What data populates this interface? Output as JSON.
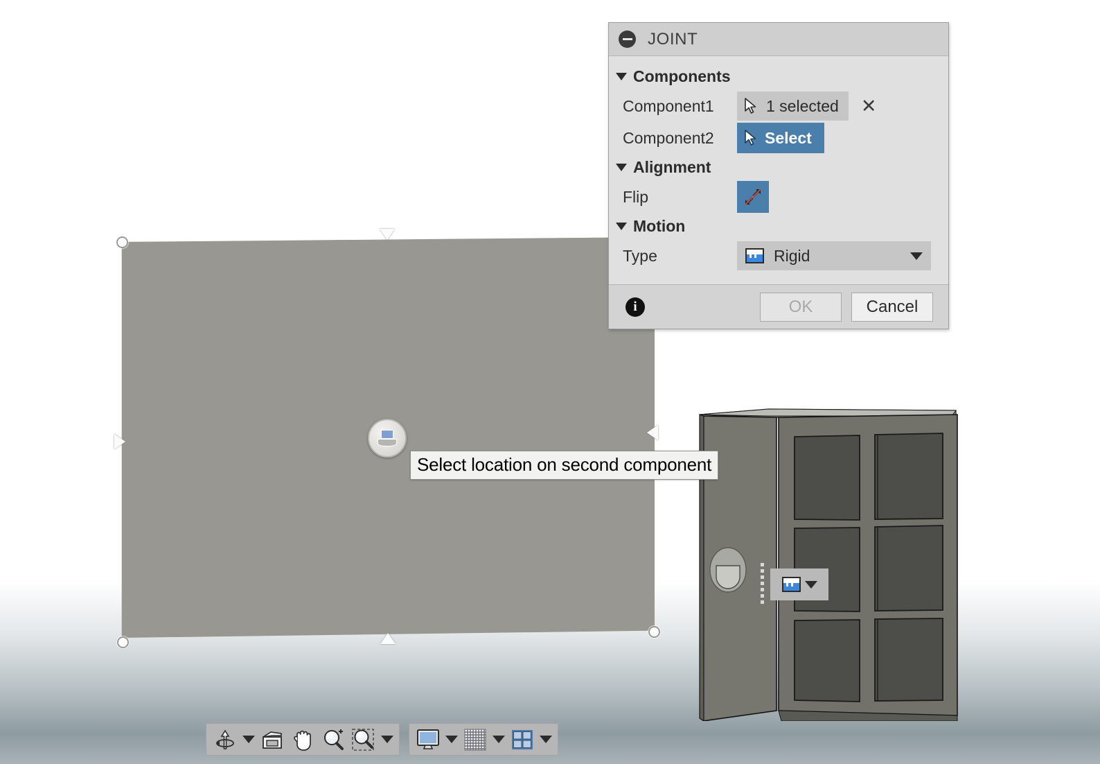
{
  "app": {
    "viewport_name": "3d-viewport"
  },
  "dialog": {
    "title": "JOINT",
    "title_icon": "minus-circle-icon",
    "sections": {
      "components": {
        "label": "Components",
        "rows": [
          {
            "label": "Component1",
            "value": "1 selected",
            "icon": "cursor-arrow-icon",
            "state": "selected",
            "clear_label": "✕"
          },
          {
            "label": "Component2",
            "value": "Select",
            "icon": "cursor-arrow-icon",
            "state": "active"
          }
        ]
      },
      "alignment": {
        "label": "Alignment",
        "rows": [
          {
            "label": "Flip",
            "icon": "flip-arrows-icon",
            "state": "active"
          }
        ]
      },
      "motion": {
        "label": "Motion",
        "rows": [
          {
            "label": "Type",
            "value": "Rigid",
            "icon": "rigid-joint-icon"
          }
        ]
      }
    },
    "footer": {
      "info_label": "i",
      "ok_label": "OK",
      "ok_enabled": false,
      "cancel_label": "Cancel"
    }
  },
  "canvas": {
    "tooltip": "Select location on second component",
    "joint_marker_name": "joint-origin-marker",
    "mini_combo": {
      "icon": "rigid-joint-icon",
      "caret": "chevron-down-icon"
    },
    "plane_color": "#989791",
    "cabinet_color": "#6e6e68"
  },
  "toolbar": {
    "groups": [
      {
        "name": "navigation",
        "items": [
          {
            "icon": "orbit-icon",
            "has_caret": true
          },
          {
            "icon": "look-at-icon",
            "has_caret": false
          },
          {
            "icon": "pan-hand-icon",
            "has_caret": false
          },
          {
            "icon": "zoom-in-icon",
            "has_caret": false
          },
          {
            "icon": "zoom-window-icon",
            "has_caret": true
          }
        ]
      },
      {
        "name": "display",
        "items": [
          {
            "icon": "display-settings-icon",
            "has_caret": true
          },
          {
            "icon": "grid-snap-icon",
            "has_caret": true
          },
          {
            "icon": "viewports-icon",
            "has_caret": true
          }
        ]
      }
    ]
  },
  "colors": {
    "accent_blue": "#4a7fab",
    "dialog_bg": "#e0e0e0",
    "titlebar_bg": "#cfcfcf",
    "field_bg": "#c6c6c6",
    "toolbar_bg": "#b6b6b6"
  }
}
